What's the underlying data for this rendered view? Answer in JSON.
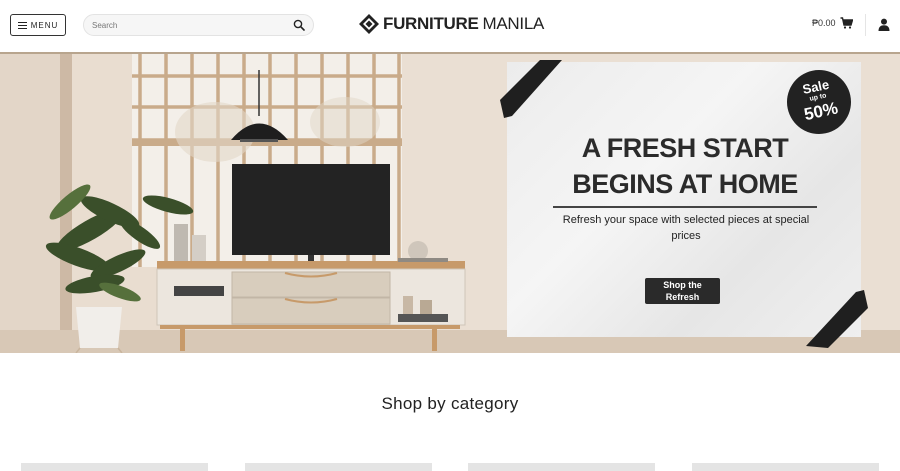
{
  "header": {
    "menu_label": "MENU",
    "search_placeholder": "Search",
    "logo_bold": "FURNITURE",
    "logo_light": "MANILA",
    "cart_total": "₱0.00"
  },
  "hero": {
    "badge": {
      "line1": "Sale",
      "line2": "up to",
      "line3": "50%"
    },
    "title_line1": "A FRESH START",
    "title_line2": "BEGINS AT HOME",
    "subtitle": "Refresh your space with selected pieces at special prices",
    "cta_line1": "Shop the",
    "cta_line2": "Refresh"
  },
  "categories": {
    "title": "Shop by category"
  },
  "icons": {
    "menu": "hamburger-icon",
    "search": "search-icon",
    "cart": "cart-icon",
    "user": "user-icon"
  },
  "colors": {
    "text": "#222222",
    "button": "#2a2a2a",
    "promo_bg": "#ececec"
  }
}
